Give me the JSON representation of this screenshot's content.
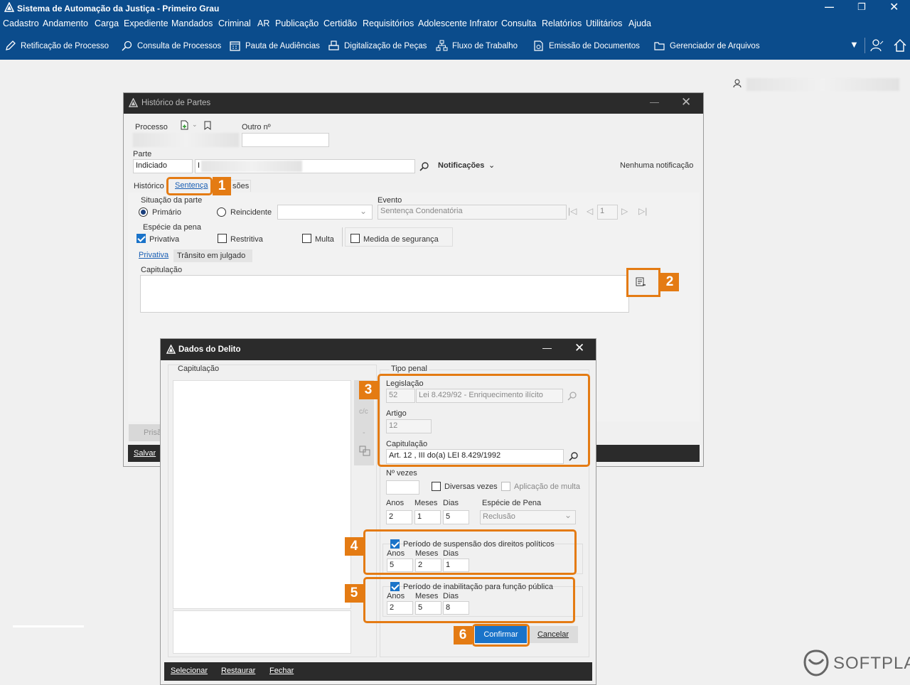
{
  "app": {
    "title": "Sistema de Automação da Justiça - Primeiro Grau",
    "menu": [
      "Cadastro",
      "Andamento",
      "Carga",
      "Expediente",
      "Mandados",
      "Criminal",
      "AR",
      "Publicação",
      "Certidão",
      "Requisitórios",
      "Adolescente Infrator",
      "Consulta",
      "Relatórios",
      "Utilitários",
      "Ajuda"
    ],
    "toolbar": [
      {
        "label": "Retificação de Processo",
        "icon": "edit-icon"
      },
      {
        "label": "Consulta de Processos",
        "icon": "search-doc-icon"
      },
      {
        "label": "Pauta de Audiências",
        "icon": "calendar-icon"
      },
      {
        "label": "Digitalização de Peças",
        "icon": "scanner-icon"
      },
      {
        "label": "Fluxo de Trabalho",
        "icon": "workflow-icon"
      },
      {
        "label": "Emissão de Documentos",
        "icon": "document-gear-icon"
      },
      {
        "label": "Gerenciador de Arquivos",
        "icon": "folder-icon"
      }
    ]
  },
  "historico": {
    "title": "Histórico de Partes",
    "processo_label": "Processo",
    "outro_label": "Outro nº",
    "parte_label": "Parte",
    "parte_tipo": "Indiciado",
    "parte_nome_prefix": "I",
    "notificacoes_label": "Notificações",
    "nenhuma": "Nenhuma notificação",
    "tabs": [
      "Histórico",
      "Sentença",
      "sões"
    ],
    "situacao_label": "Situação da parte",
    "primario": "Primário",
    "reincidente": "Reincidente",
    "evento_label": "Evento",
    "evento_value": "Sentença Condenatória",
    "evento_num": "1",
    "especie_label": "Espécie da pena",
    "privativa": "Privativa",
    "restritiva": "Restritiva",
    "multa": "Multa",
    "medida": "Medida de segurança",
    "subtabs": [
      "Privativa",
      "Trânsito em julgado"
    ],
    "capitulacao_label": "Capitulação",
    "prisao_partial": "Prisã",
    "salvar": "Salvar"
  },
  "dados": {
    "title": "Dados do Delito",
    "capitulacao_label": "Capitulação",
    "tipo_penal_label": "Tipo penal",
    "side_buttons": [
      "c/c",
      "-"
    ],
    "legislacao_label": "Legislação",
    "legislacao_code": "52",
    "legislacao_desc": "Lei 8.429/92 - Enriquecimento ilícito",
    "artigo_label": "Artigo",
    "artigo_value": "12",
    "capitulacao_value": "Art. 12 , III do(a) LEI 8.429/1992",
    "nvezes_label": "Nº vezes",
    "diversas_vezes": "Diversas vezes",
    "aplicacao_multa": "Aplicação de multa",
    "anos_label": "Anos",
    "meses_label": "Meses",
    "dias_label": "Dias",
    "especie_pena_label": "Espécie de Pena",
    "pena": {
      "anos": "2",
      "meses": "1",
      "dias": "5"
    },
    "especie_pena_value": "Reclusão",
    "suspensao_label": "Período de suspensão dos direitos políticos",
    "suspensao": {
      "anos": "5",
      "meses": "2",
      "dias": "1"
    },
    "inabilitacao_label": "Período de inabilitação para função pública",
    "inabilitacao": {
      "anos": "2",
      "meses": "5",
      "dias": "8"
    },
    "confirmar": "Confirmar",
    "cancelar": "Cancelar",
    "footer": [
      "Selecionar",
      "Restaurar",
      "Fechar"
    ]
  },
  "badges": [
    "1",
    "2",
    "3",
    "4",
    "5",
    "6"
  ],
  "brand": "SOFTPLAN",
  "colors": {
    "header": "#0b4c8c",
    "highlight": "#e47b13",
    "primary_button": "#1a73c9"
  }
}
